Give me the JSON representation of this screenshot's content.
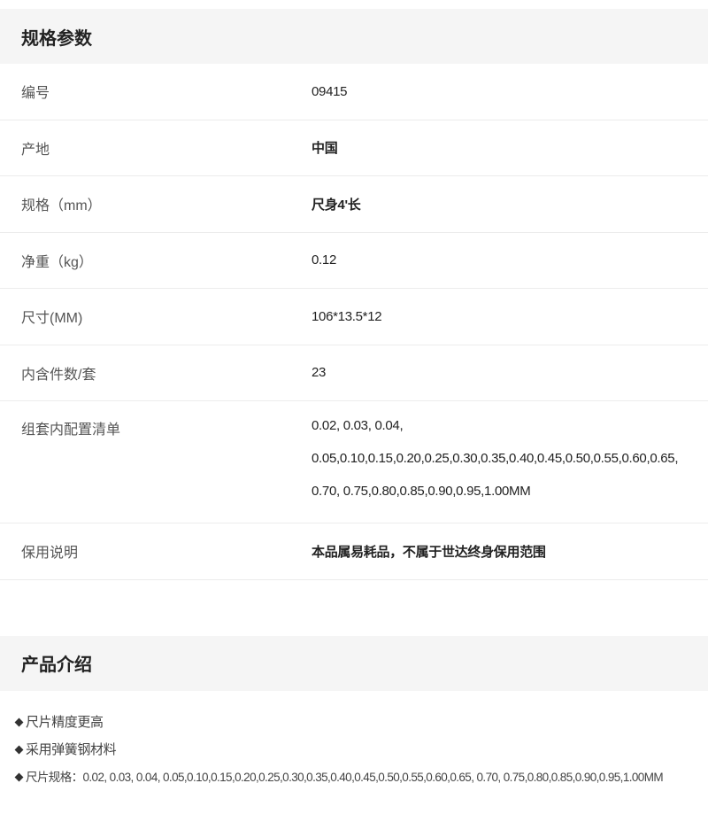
{
  "spec_section": {
    "title": "规格参数",
    "rows": [
      {
        "label": "编号",
        "value": "09415"
      },
      {
        "label": "产地",
        "value": "中国"
      },
      {
        "label": "规格（mm）",
        "value": "尺身4'长"
      },
      {
        "label": "净重（kg）",
        "value": "0.12"
      },
      {
        "label": "尺寸(MM)",
        "value": "106*13.5*12"
      },
      {
        "label": "内含件数/套",
        "value": "23"
      },
      {
        "label": "组套内配置清单",
        "value_lines": [
          "0.02, 0.03, 0.04,",
          "0.05,0.10,0.15,0.20,0.25,0.30,0.35,0.40,0.45,0.50,0.55,0.60,0.65,",
          "0.70, 0.75,0.80,0.85,0.90,0.95,1.00MM"
        ]
      },
      {
        "label": "保用说明",
        "value": "本品属易耗品，不属于世达终身保用范围"
      }
    ]
  },
  "intro_section": {
    "title": "产品介绍",
    "items": [
      "尺片精度更高",
      "采用弹簧钢材料",
      "尺片规格：0.02, 0.03, 0.04, 0.05,0.10,0.15,0.20,0.25,0.30,0.35,0.40,0.45,0.50,0.55,0.60,0.65, 0.70, 0.75,0.80,0.85,0.90,0.95,1.00MM"
    ]
  }
}
